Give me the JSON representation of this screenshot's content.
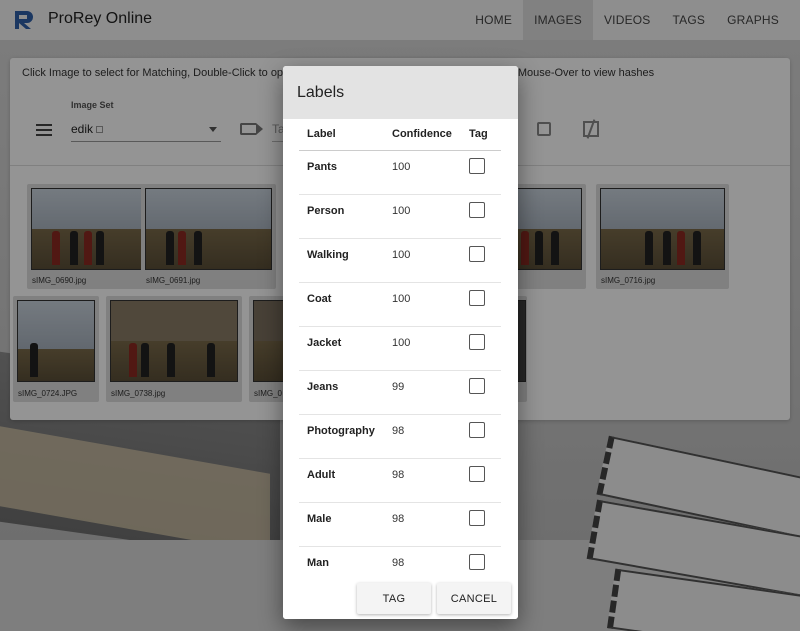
{
  "app": {
    "title": "ProRey Online"
  },
  "nav": {
    "tabs": [
      "HOME",
      "IMAGES",
      "VIDEOS",
      "TAGS",
      "GRAPHS"
    ],
    "active": "IMAGES"
  },
  "main": {
    "instructions": "Click Image to select for Matching, Double-Click to open Image, Right-Click to delete Image from Set, Mouse-Over to view hashes",
    "image_set_label": "Image Set",
    "image_set_value": "edik",
    "tag_placeholder": "Ta",
    "thumbnails": [
      {
        "caption": "sIMG_0690.jpg"
      },
      {
        "caption": "sIMG_0691.jpg"
      },
      {
        "caption": ""
      },
      {
        "caption": ""
      },
      {
        "caption": "sIMG_0716.jpg"
      },
      {
        "caption": "sIMG_0724.JPG"
      },
      {
        "caption": "sIMG_0738.jpg"
      },
      {
        "caption": "sIMG_0"
      },
      {
        "caption": ""
      }
    ]
  },
  "dialog": {
    "title": "Labels",
    "columns": {
      "label": "Label",
      "confidence": "Confidence",
      "tag": "Tag"
    },
    "rows": [
      {
        "label": "Pants",
        "confidence": "100"
      },
      {
        "label": "Person",
        "confidence": "100"
      },
      {
        "label": "Walking",
        "confidence": "100"
      },
      {
        "label": "Coat",
        "confidence": "100"
      },
      {
        "label": "Jacket",
        "confidence": "100"
      },
      {
        "label": "Jeans",
        "confidence": "99"
      },
      {
        "label": "Photography",
        "confidence": "98"
      },
      {
        "label": "Adult",
        "confidence": "98"
      },
      {
        "label": "Male",
        "confidence": "98"
      },
      {
        "label": "Man",
        "confidence": "98"
      }
    ],
    "buttons": {
      "tag": "TAG",
      "cancel": "CANCEL"
    }
  },
  "colors": {
    "appbar": "#f5f5f5",
    "active_tab": "#dedede",
    "dialog_header": "#e3e3e3",
    "logo": "#2f5fa8"
  },
  "icons": [
    "logo-icon",
    "menu-icon",
    "tag-icon",
    "save-icon",
    "compare-icon",
    "checkbox-icon"
  ]
}
